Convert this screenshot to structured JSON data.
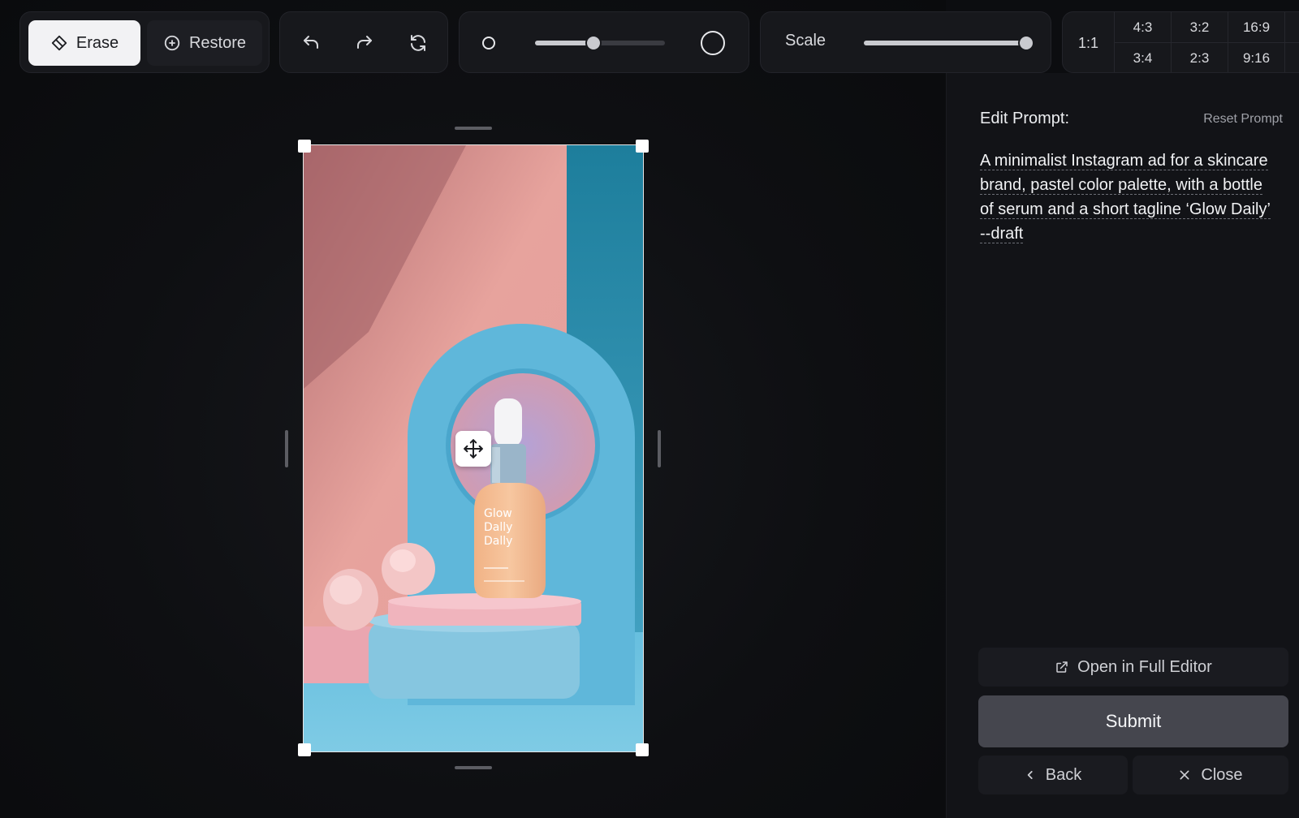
{
  "toolbar": {
    "erase_label": "Erase",
    "restore_label": "Restore",
    "brush_size_level": 0.45,
    "scale_label": "Scale",
    "scale_level": 1.0
  },
  "aspect_ratios": {
    "main": "1:1",
    "options": [
      "4:3",
      "3:2",
      "16:9",
      "3:4",
      "2:3",
      "9:16"
    ]
  },
  "image": {
    "bottle_text": [
      "Glow",
      "Dally",
      "Dally"
    ]
  },
  "panel": {
    "title": "Edit Prompt:",
    "reset_label": "Reset Prompt",
    "prompt_lines": [
      "A minimalist Instagram ad for a skincare",
      "brand, pastel color palette, with a bottle",
      "of serum and a short tagline ‘Glow Daily’",
      "--draft"
    ],
    "open_editor_label": "Open in Full Editor",
    "submit_label": "Submit",
    "back_label": "Back",
    "close_label": "Close"
  },
  "colors": {
    "background": "#0c0d10",
    "panel": "#121317",
    "accent_light": "#f2f2f4",
    "pink": "#e9a0a0",
    "sky_blue": "#6ec1de"
  }
}
